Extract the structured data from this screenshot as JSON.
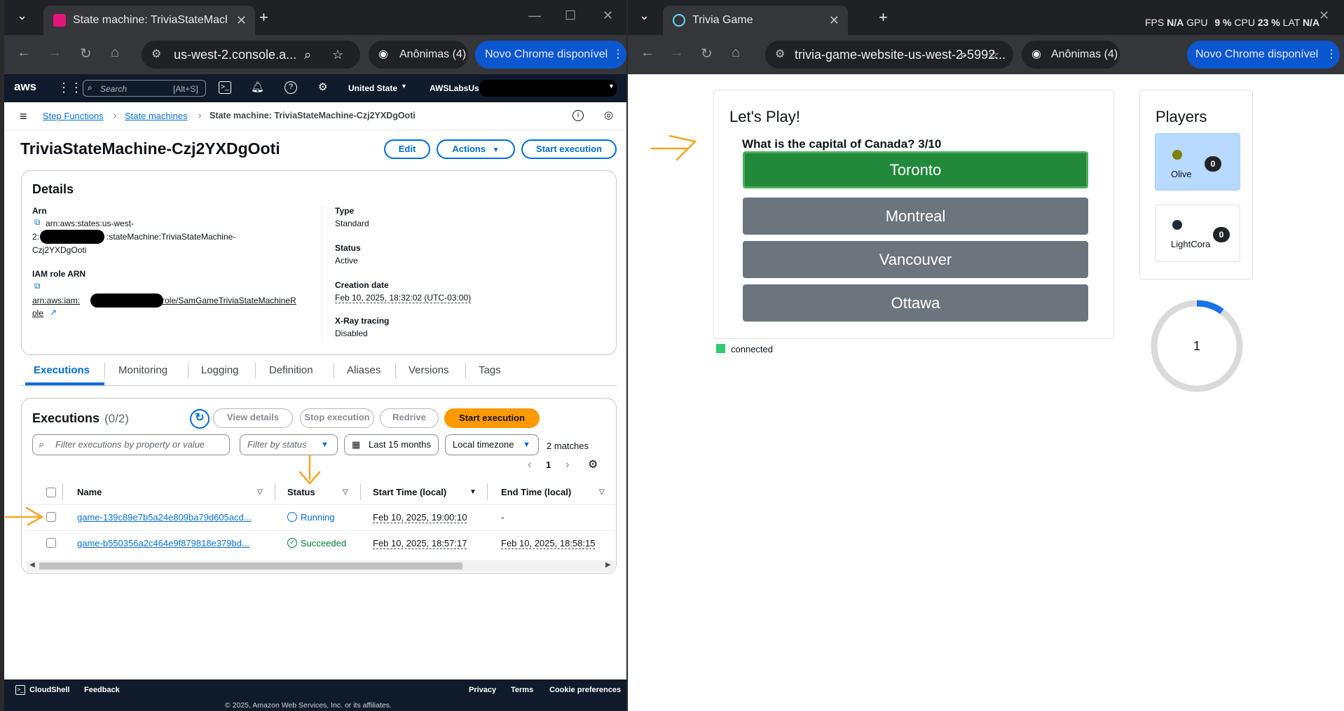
{
  "left_browser": {
    "tab_title": "State machine: TriviaStateMachi",
    "url": "us-west-2.console.a...",
    "incognito_label": "Anônimas (4)",
    "update_label": "Novo Chrome disponível"
  },
  "right_browser": {
    "tab_title": "Trivia Game",
    "url": "trivia-game-website-us-west-2-5992...",
    "incognito_label": "Anônimas (4)",
    "update_label": "Novo Chrome disponível",
    "perf_overlay": {
      "fps_label": "FPS",
      "fps": "N/A",
      "gpu_label": "GPU",
      "gpu": "9 %",
      "cpu_label": "CPU",
      "cpu": "23 %",
      "lat_label": "LAT",
      "lat": "N/A"
    }
  },
  "aws_nav": {
    "logo": "aws",
    "search_placeholder": "Search",
    "search_shortcut": "[Alt+S]",
    "region": "United State",
    "account": "AWSLabsUse"
  },
  "breadcrumb": {
    "items": [
      "Step Functions",
      "State machines"
    ],
    "current": "State machine: TriviaStateMachine-Czj2YXDgOoti"
  },
  "page": {
    "title": "TriviaStateMachine-Czj2YXDgOoti",
    "edit_label": "Edit",
    "actions_label": "Actions",
    "start_label": "Start execution"
  },
  "details": {
    "heading": "Details",
    "arn_label": "Arn",
    "arn_line1": "arn:aws:states:us-west-",
    "arn_line2a": "2:",
    "arn_line2b": ":stateMachine:TriviaStateMachine-",
    "arn_line3": "Czj2YXDgOoti",
    "iam_label": "IAM role ARN",
    "iam_line1a": "arn:aws:iam:",
    "iam_line1b": "role/SamGameTriviaStateMachineR",
    "iam_line2": "ole",
    "type_label": "Type",
    "type_value": "Standard",
    "status_label": "Status",
    "status_value": "Active",
    "creation_label": "Creation date",
    "creation_value": "Feb 10, 2025, 18:32:02 (UTC-03:00)",
    "xray_label": "X-Ray tracing",
    "xray_value": "Disabled"
  },
  "tabs": [
    "Executions",
    "Monitoring",
    "Logging",
    "Definition",
    "Aliases",
    "Versions",
    "Tags"
  ],
  "executions": {
    "heading": "Executions",
    "count": "(0/2)",
    "view_details": "View details",
    "stop": "Stop execution",
    "redrive": "Redrive",
    "start": "Start execution",
    "filter_placeholder": "Filter executions by property or value",
    "status_filter": "Filter by status",
    "range": "Last 15 months",
    "timezone": "Local timezone",
    "matches": "2 matches",
    "page": "1",
    "columns": [
      "Name",
      "Status",
      "Start Time (local)",
      "End Time (local)"
    ],
    "rows": [
      {
        "name": "game-139c89e7b5a24e809ba79d605acd...",
        "status": "Running",
        "start": "Feb 10, 2025, 19:00:10",
        "end": "-"
      },
      {
        "name": "game-b550356a2c464e9f879818e379bd...",
        "status": "Succeeded",
        "start": "Feb 10, 2025, 18:57:17",
        "end": "Feb 10, 2025, 18:58:15"
      }
    ]
  },
  "footer": {
    "cloudshell": "CloudShell",
    "feedback": "Feedback",
    "privacy": "Privacy",
    "terms": "Terms",
    "cookies": "Cookie preferences",
    "copyright": "© 2025, Amazon Web Services, Inc. or its affiliates."
  },
  "trivia": {
    "heading": "Let's Play!",
    "question": "What is the capital of Canada? 3/10",
    "answers": [
      "Toronto",
      "Montreal",
      "Vancouver",
      "Ottawa"
    ],
    "connection": "connected",
    "players_heading": "Players",
    "players": [
      {
        "name": "Olive",
        "score": "0",
        "color": "#808000"
      },
      {
        "name": "LightCora",
        "score": "0",
        "color": "#1f2937"
      }
    ],
    "timer": "1",
    "timer_fraction": 0.1
  },
  "colors": {
    "aws_blue": "#006ce0",
    "aws_orange": "#ff9900",
    "correct_green": "#22883a",
    "answer_gray": "#6c757d",
    "annotation": "#f5a623"
  }
}
